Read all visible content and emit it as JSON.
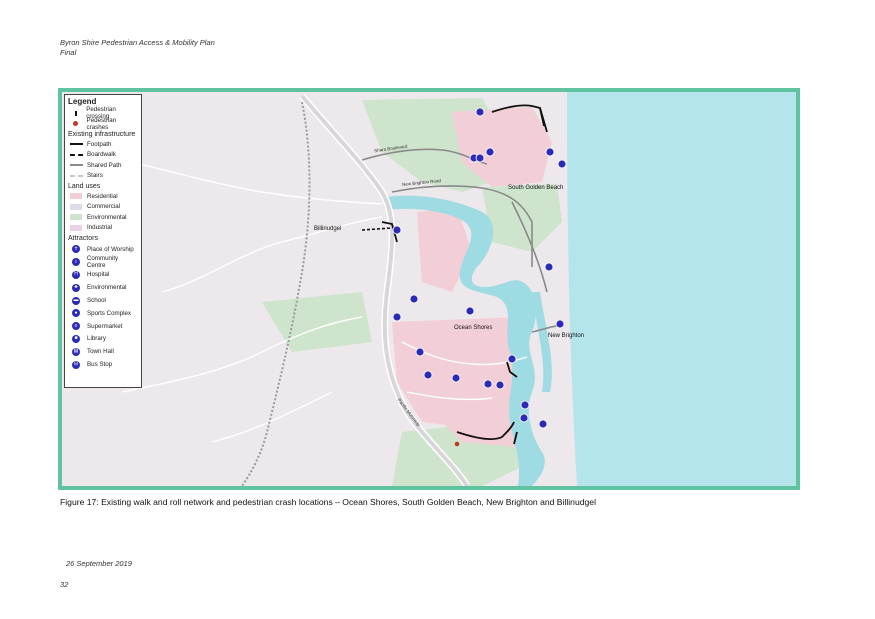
{
  "header": {
    "line1": "Byron Shire Pedestrian Access & Mobility Plan",
    "line2": "Final"
  },
  "colors": {
    "frame": "#5fc3a0",
    "ocean": "#b3e5ea",
    "water": "#9fdbe3",
    "residential": "#f2cfd6",
    "commercial": "#dcdcea",
    "environmental": "#cfe4cc",
    "industrial": "#e6d3e6",
    "marker": "#2b2bb8",
    "crash": "#c0392b"
  },
  "legend": {
    "title": "Legend",
    "points": [
      {
        "label": "Pedestrian crossing",
        "icon": "pedestrian-crossing-icon"
      },
      {
        "label": "Pedestrian crashes",
        "icon": "crash-dot-icon"
      }
    ],
    "infra_title": "Existing infrastructure",
    "infra": [
      {
        "label": "Footpath",
        "style": "solid-thick"
      },
      {
        "label": "Boardwalk",
        "style": "dashed"
      },
      {
        "label": "Shared Path",
        "style": "solid-grey"
      },
      {
        "label": "Stairs",
        "style": "dashed-light"
      }
    ],
    "landuse_title": "Land uses",
    "landuse": [
      {
        "label": "Residential",
        "color": "#f2cfd6"
      },
      {
        "label": "Commercial",
        "color": "#dcdcea"
      },
      {
        "label": "Environmental",
        "color": "#cfe4cc"
      },
      {
        "label": "Industrial",
        "color": "#e6d3e6"
      }
    ],
    "attractors_title": "Attractors",
    "attractors": [
      {
        "label": "Place of Worship",
        "glyph": "✝",
        "icon": "place-of-worship-icon"
      },
      {
        "label": "Community Centre",
        "glyph": "i",
        "icon": "community-centre-icon"
      },
      {
        "label": "Hospital",
        "glyph": "H",
        "icon": "hospital-icon"
      },
      {
        "label": "Environmental",
        "glyph": "♣",
        "icon": "environmental-icon"
      },
      {
        "label": "School",
        "glyph": "▬",
        "icon": "school-icon"
      },
      {
        "label": "Sports Complex",
        "glyph": "●",
        "icon": "sports-complex-icon"
      },
      {
        "label": "Supermarket",
        "glyph": "≡",
        "icon": "supermarket-icon"
      },
      {
        "label": "Library",
        "glyph": "■",
        "icon": "library-icon"
      },
      {
        "label": "Town Hall",
        "glyph": "▤",
        "icon": "town-hall-icon"
      },
      {
        "label": "Bus Stop",
        "glyph": "⊟",
        "icon": "bus-stop-icon"
      }
    ]
  },
  "map": {
    "places": [
      "Billinudgel",
      "South Golden Beach",
      "Ocean Shores",
      "New Brighton"
    ],
    "roads": [
      "Shara Boulevard",
      "New Brighton Road",
      "Pacific Motorway"
    ]
  },
  "caption": "Figure 17: Existing walk and roll network and pedestrian crash locations – Ocean Shores, South Golden Beach, New Brighton and Billinudgel",
  "footer": {
    "date": "26 September 2019",
    "page": "32"
  }
}
